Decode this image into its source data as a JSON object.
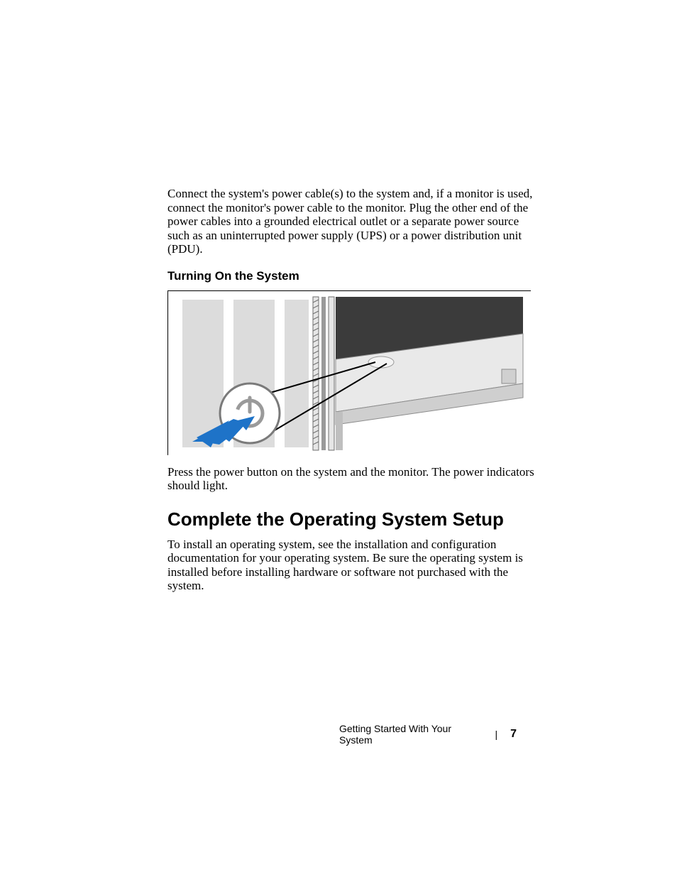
{
  "body": {
    "para1": "Connect the system's power cable(s) to the system and, if a monitor is used, connect the monitor's power cable to the monitor. Plug the other end of the power cables into a grounded electrical outlet or a separate power source such as an uninterrupted power supply (UPS) or a power distribution unit (PDU).",
    "subhead1": "Turning On the System",
    "para2": "Press the power button on the system and the monitor. The power indicators should light.",
    "heading1": "Complete the Operating System Setup",
    "para3": "To install an operating system, see the installation and configuration documentation for your operating system. Be sure the operating system is installed before installing hardware or software not purchased with the system."
  },
  "footer": {
    "section": "Getting Started With Your System",
    "separator": "|",
    "page": "7"
  }
}
